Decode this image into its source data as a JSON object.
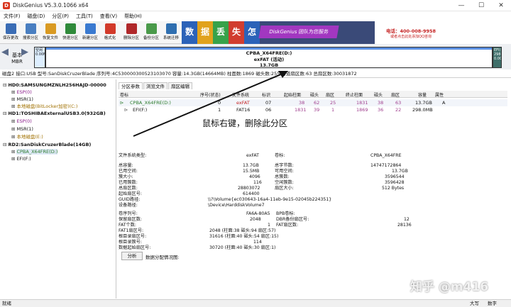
{
  "window": {
    "title": "DiskGenius V5.3.0.1066 x64",
    "minimize": "—",
    "maximize": "☐",
    "close": "✕"
  },
  "menu": [
    "文件(F)",
    "磁盘(D)",
    "分区(P)",
    "工具(T)",
    "查看(V)",
    "帮助(H)"
  ],
  "toolbar": [
    {
      "label": "保存更改",
      "icon": "save-icon",
      "color": "#3b6db5"
    },
    {
      "label": "搜索分区",
      "icon": "search-partition-icon",
      "color": "#4a7fc1"
    },
    {
      "label": "恢复文件",
      "icon": "recover-files-icon",
      "color": "#d99a22"
    },
    {
      "label": "快速分区",
      "icon": "quick-partition-icon",
      "color": "#2f8a3a"
    },
    {
      "label": "新建分区",
      "icon": "new-partition-icon",
      "color": "#3a7ad0"
    },
    {
      "label": "格式化",
      "icon": "format-icon",
      "color": "#d23a2a"
    },
    {
      "label": "删除分区",
      "icon": "delete-partition-icon",
      "color": "#b0282a"
    },
    {
      "label": "备份分区",
      "icon": "backup-partition-icon",
      "color": "#4a9a4a"
    },
    {
      "label": "系统迁移",
      "icon": "system-migration-icon",
      "color": "#2f6fb0"
    }
  ],
  "banner": {
    "chars": [
      "数",
      "据",
      "丢",
      "失",
      "怎",
      "么",
      "办"
    ],
    "char_colors": [
      "#2b62b8",
      "#e1a21c",
      "#37a24a",
      "#d13d2f",
      "#2b62b8",
      "#9c37b6",
      "#e1a21c"
    ],
    "slogan": "DiskGenius 团队为您服务",
    "phone": "电话：400-008-9958",
    "phone_sub": "或者点击此处添加QQ咨询"
  },
  "disk_strip": {
    "mbr_label": "基本\nMBR",
    "left_partition": "空闲\n0.00MB",
    "main_partition": {
      "name": "CPBA_X64FRE(D:)",
      "fs": "exFAT (活动)",
      "size": "13.7GB"
    },
    "right_partition": "EFI(F:)\n298\n0.00"
  },
  "disk_info": "磁盘2 接口:USB 型号:SanDiskCruzerBlade 序列号:4C530000300523103070 容量:14.3GB(14664MB) 柱面数:1869 磁头数:255 每道扇区数:63 总扇区数:30031872",
  "tree": {
    "disks": [
      {
        "label": "HD0:SAMSUNGMZNLH256HAJD-00000",
        "children": [
          {
            "label": "ESP(0)",
            "color": "#8a1a8a"
          },
          {
            "label": "MSR(1)",
            "color": "#111"
          },
          {
            "label": "本地磁盘(BitLocker加密)(C:)",
            "color": "#a07000"
          }
        ]
      },
      {
        "label": "HD1:TOSHIBAExternalUSB3.0(932GB)",
        "children": [
          {
            "label": "ESP(0)",
            "color": "#8a1a8a"
          },
          {
            "label": "MSR(1)",
            "color": "#111"
          },
          {
            "label": "本地磁盘(E:)",
            "color": "#a07000"
          }
        ]
      },
      {
        "label": "RD2:SanDiskCruzerBlade(14GB)",
        "children": [
          {
            "label": "CPBA_X64FRE(D:)",
            "color": "#2a7a2a"
          },
          {
            "label": "EFI(F:)",
            "color": "#111"
          }
        ]
      }
    ]
  },
  "tabs": [
    "分区参数",
    "浏览文件",
    "扇区编辑"
  ],
  "table": {
    "headers": [
      "卷标",
      "序号(状态)",
      "文件系统",
      "标识",
      "起始柱面",
      "磁头",
      "扇区",
      "终止柱面",
      "磁头",
      "扇区",
      "容量",
      "属性"
    ],
    "rows": [
      [
        "CPBA_X64FRE(D:)",
        "0",
        "exFAT",
        "07",
        "38",
        "62",
        "25",
        "1831",
        "38",
        "63",
        "13.7GB",
        "A"
      ],
      [
        "EFI(F:)",
        "1",
        "FAT16",
        "06",
        "1831",
        "39",
        "1",
        "1869",
        "36",
        "22",
        "298.0MB",
        ""
      ]
    ]
  },
  "annotation": "鼠标右键，删除此分区",
  "details": {
    "left": [
      [
        "文件系统类型:",
        "exFAT"
      ],
      [
        "",
        ""
      ],
      [
        "总容量:",
        "13.7GB"
      ],
      [
        "已用空间:",
        "15.5MB"
      ],
      [
        "簇大小:",
        "4096"
      ],
      [
        "已用簇数:",
        "116"
      ],
      [
        "总扇区数:",
        "28803072"
      ],
      [
        "起始扇区号:",
        "614400"
      ],
      [
        "GUID路径:",
        "\\\\?\\Volume{ec030643-16a4-11eb-9e15-02045b224351}"
      ],
      [
        "设备路径:",
        "\\Device\\HarddiskVolume7"
      ]
    ],
    "right": [
      [
        "卷标:",
        "CPBA_X64FRE"
      ],
      [
        "",
        ""
      ],
      [
        "总字节数:",
        "14747172864"
      ],
      [
        "可用空间:",
        "13.7GB"
      ],
      [
        "总簇数:",
        "3596544"
      ],
      [
        "空闲簇数:",
        "3596428"
      ],
      [
        "扇区大小:",
        "512 Bytes"
      ]
    ],
    "lower_left": [
      [
        "卷序列号:",
        "FA6A-80A5"
      ],
      [
        "保留扇区数:",
        "2048"
      ],
      [
        "FAT个数:",
        "1"
      ],
      [
        "FAT1扇区号:",
        "2048 (柱面:38 磁头:94 扇区:57)"
      ],
      [
        "根目录扇区号:",
        "31616 (柱面:40 磁头:54 扇区:15)"
      ],
      [
        "根目录簇号:",
        "114"
      ],
      [
        "数据起始扇区号:",
        "30720 (柱面:40 磁头:30 扇区:1)"
      ]
    ],
    "lower_right": [
      [
        "BPB卷标:",
        ""
      ],
      [
        "DBR备份扇区号:",
        "12"
      ],
      [
        "FAT扇区数:",
        "28136"
      ]
    ]
  },
  "analyze_button": "分析",
  "analyze_label": "数据分配情况图:",
  "watermark": "知乎 @m416",
  "status": {
    "left": "就绪",
    "caps": "大写",
    "num": "数字"
  }
}
